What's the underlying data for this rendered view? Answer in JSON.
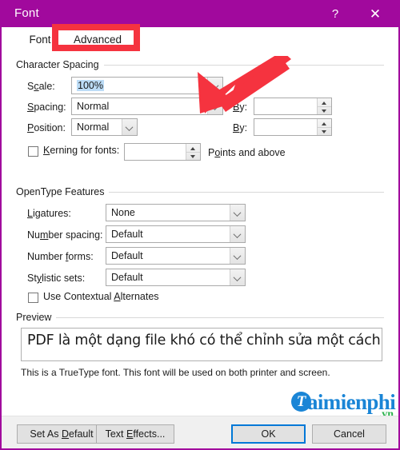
{
  "window": {
    "title": "Font",
    "help_icon": "?",
    "close_icon": "✕",
    "accent_color": "#a1099d"
  },
  "tabs": [
    {
      "id": "font",
      "label": "Font"
    },
    {
      "id": "advanced",
      "label": "Advanced",
      "selected": true
    }
  ],
  "character_spacing": {
    "group_label": "Character Spacing",
    "scale": {
      "label": "Scale:",
      "value": "100%",
      "selected": true
    },
    "spacing": {
      "label": "Spacing:",
      "value": "Normal",
      "by_label": "By:",
      "by_value": ""
    },
    "position": {
      "label": "Position:",
      "value": "Normal",
      "by_label": "By:",
      "by_value": ""
    },
    "kerning": {
      "label": "Kerning for fonts:",
      "checked": false,
      "value": "",
      "suffix": "Points and above"
    }
  },
  "opentype_features": {
    "group_label": "OpenType Features",
    "rows": [
      {
        "label": "Ligatures:",
        "value": "None"
      },
      {
        "label": "Number spacing:",
        "value": "Default"
      },
      {
        "label": "Number forms:",
        "value": "Default"
      },
      {
        "label": "Stylistic sets:",
        "value": "Default"
      }
    ],
    "contextual_alternates": {
      "label": "Use Contextual Alternates",
      "checked": false
    }
  },
  "preview": {
    "group_label": "Preview",
    "sample_text": "PDF là một dạng file khó có thể chỉnh sửa một cách",
    "note": "This is a TrueType font. This font will be used on both printer and screen."
  },
  "watermark": {
    "mark_letter": "T",
    "name": "aimienphi",
    "tld": ".vn",
    "brand_color": "#1a85d6",
    "tld_color": "#2bb24c"
  },
  "buttons": {
    "set_as_default": "Set As Default",
    "text_effects": "Text Effects...",
    "ok": "OK",
    "cancel": "Cancel"
  },
  "annotations": {
    "highlight_color": "#f5333f",
    "rect_target": "advanced-tab",
    "arrow_target": "spacing-dropdown"
  }
}
